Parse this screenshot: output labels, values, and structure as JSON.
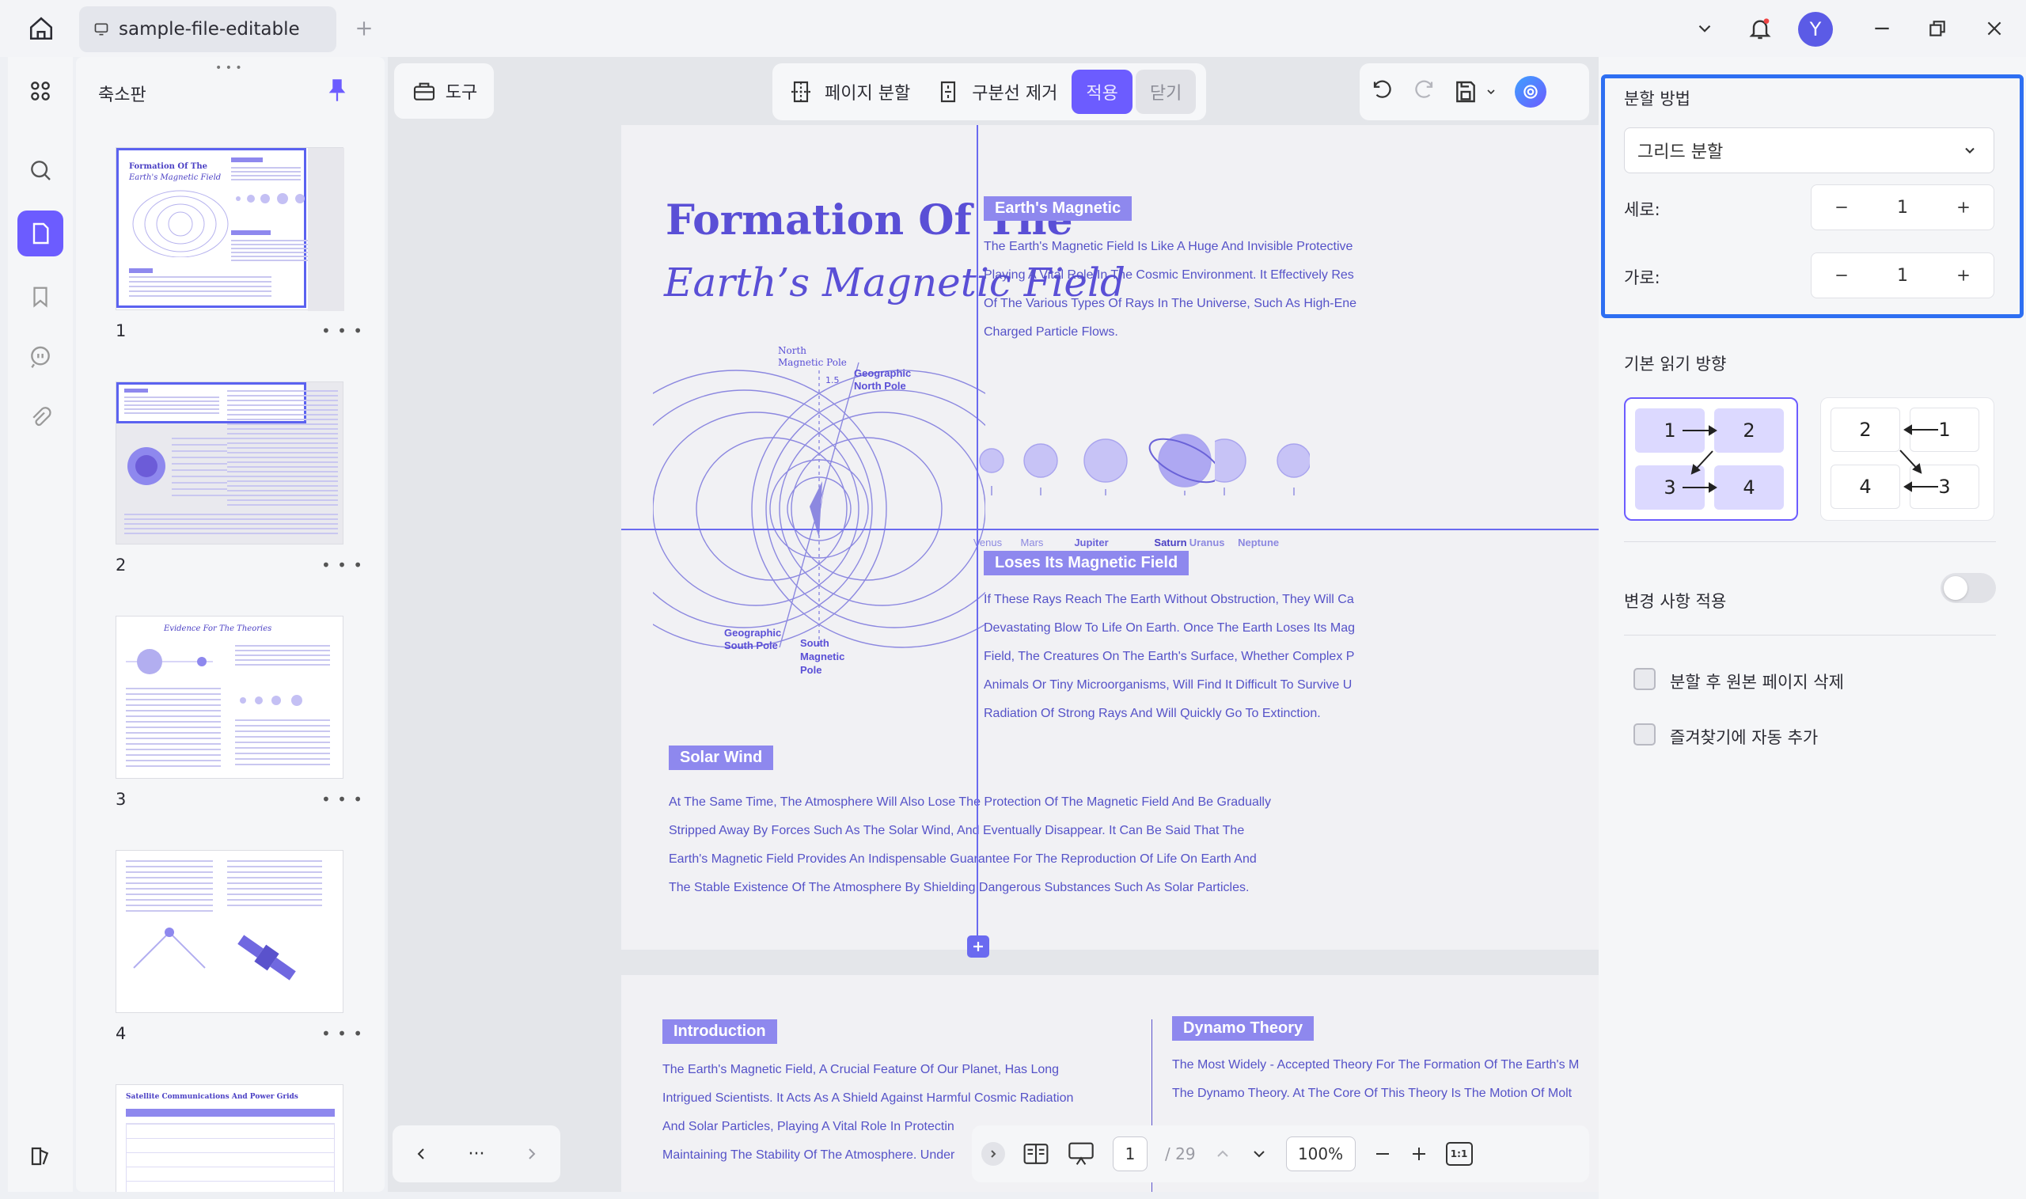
{
  "tab": {
    "title": "sample-file-editable"
  },
  "user": {
    "initial": "Y"
  },
  "sidebar": {
    "title": "축소판"
  },
  "thumbnails": [
    {
      "num": "1",
      "title": "Formation Of The",
      "subtitle": "Earth's Magnetic Field"
    },
    {
      "num": "2"
    },
    {
      "num": "3",
      "title": "Evidence For The Theories"
    },
    {
      "num": "4"
    },
    {
      "title": "Satellite Communications And Power Grids"
    }
  ],
  "toolbar": {
    "tools_label": "도구",
    "split_page_label": "페이지 분할",
    "remove_divider_label": "구분선 제거",
    "apply_label": "적용",
    "close_label": "닫기"
  },
  "page1": {
    "title_line1": "Formation Of The",
    "title_line2": "Earth’s Magnetic Field",
    "diagram_labels": {
      "north_magnetic_pole_1": "North",
      "north_magnetic_pole_2": "Magnetic Pole",
      "geographic_north_1": "Geographic",
      "geographic_north_2": "North Pole",
      "geographic_south_1": "Geographic",
      "geographic_south_2": "South Pole",
      "south_magnetic_1": "South",
      "south_magnetic_2": "Magnetic",
      "south_magnetic_3": "Pole",
      "angle": "1.5"
    },
    "earths_magnetic_tag": "Earth's Magnetic",
    "earths_magnetic_lines": [
      "The Earth's Magnetic Field Is Like A Huge And Invisible Protective",
      "Playing A Vital Role In The Cosmic Environment. It Effectively Res",
      "Of The Various Types Of Rays In The Universe, Such As High-Ene",
      "Charged Particle Flows."
    ],
    "planets": [
      "Venus",
      "Mars",
      "Jupiter",
      "Saturn",
      "Uranus",
      "Neptune"
    ],
    "loses_tag": "Loses Its Magnetic Field",
    "loses_lines": [
      "If These Rays Reach The Earth Without Obstruction, They Will Ca",
      "Devastating Blow To Life On Earth. Once The Earth Loses Its Mag",
      "Field, The Creatures On The Earth's Surface, Whether Complex P",
      "Animals Or Tiny Microorganisms, Will Find It Difficult To Survive U",
      "Radiation Of Strong Rays And Will Quickly Go To Extinction."
    ],
    "solar_tag": "Solar Wind",
    "solar_lines": [
      "At The Same Time, The Atmosphere Will Also Lose The Protection Of The Magnetic Field And Be Gradually",
      "Stripped Away By Forces Such As The Solar Wind, And Eventually Disappear. It Can Be Said That The",
      "Earth's Magnetic Field Provides An Indispensable Guarantee For The Reproduction Of Life On Earth And",
      "The Stable Existence Of The Atmosphere By Shielding Dangerous Substances Such As Solar Particles."
    ]
  },
  "page2": {
    "intro_tag": "Introduction",
    "intro_lines": [
      "The Earth's Magnetic Field, A Crucial Feature Of Our Planet, Has Long",
      "Intrigued Scientists. It Acts As A Shield Against Harmful Cosmic Radiation",
      "And Solar Particles, Playing A Vital Role In Protectin",
      "Maintaining The Stability Of The Atmosphere. Under"
    ],
    "dynamo_tag": "Dynamo Theory",
    "dynamo_lines": [
      "The Most Widely - Accepted Theory For The Formation Of The Earth's M",
      "The Dynamo Theory. At The Core Of This Theory Is The Motion Of Molt"
    ]
  },
  "bottom_nav": {
    "more": "···",
    "current_page": "1",
    "total_pages": "/ 29",
    "zoom": "100%",
    "fit_label": "1:1"
  },
  "split_panel": {
    "method_label": "분할 방법",
    "method_value": "그리드 분할",
    "rows_label": "세로:",
    "rows_value": "1",
    "cols_label": "가로:",
    "cols_value": "1",
    "reading_dir_label": "기본 읽기 방향",
    "dir1": [
      "1",
      "2",
      "3",
      "4"
    ],
    "dir2": [
      "2",
      "1",
      "4",
      "3"
    ],
    "apply_changes_label": "변경 사항 적용",
    "delete_original_label": "분할 후 원본 페이지 삭제",
    "add_bookmark_label": "즐겨찾기에 자동 추가"
  }
}
